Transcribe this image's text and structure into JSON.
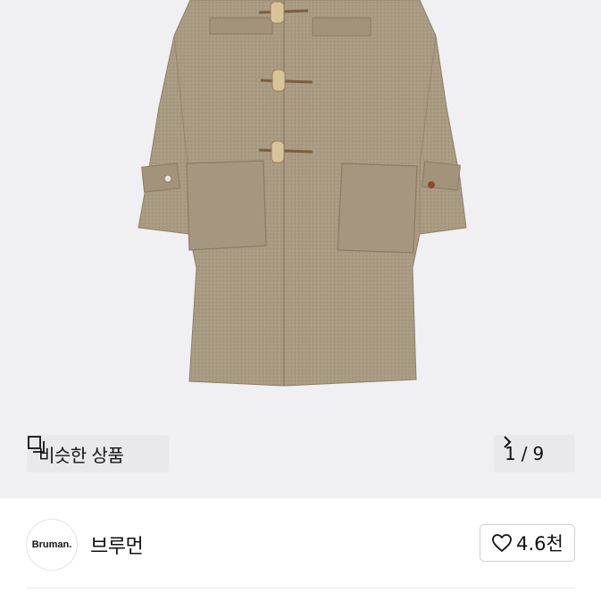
{
  "product_image": {
    "alt_icon": "duffle-coat-image"
  },
  "similar_button": {
    "label": "비슷한 상품",
    "icon": "similar-items-icon"
  },
  "pager": {
    "current": "1",
    "separator": "/",
    "total": "9",
    "icon": "chevron-right-icon"
  },
  "shop": {
    "logo_text": "Bruman.",
    "name": "브루먼"
  },
  "like_button": {
    "count": "4.6천",
    "icon": "heart-outline-icon"
  },
  "colors": {
    "coat": "#a99a82",
    "background": "#f0f0f2",
    "overlay_button": "#e8e8ea",
    "border": "#cfcfcf"
  }
}
